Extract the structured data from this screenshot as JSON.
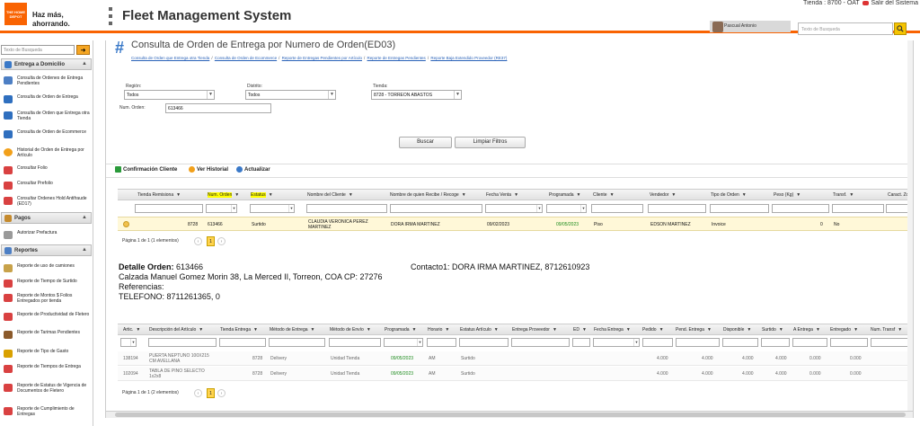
{
  "header": {
    "logo_text": "THE HOME DEPOT",
    "slogan_line1": "Haz más,",
    "slogan_line2": "ahorrando.",
    "app_title": "Fleet Management System",
    "store_info": "Tienda : 8700 - OAT",
    "logout_label": "Salir del Sistema",
    "user_name": "Pascual Antonio",
    "search_placeholder": "Texto de Busqueda"
  },
  "sidebar": {
    "search_placeholder": "Texto de Busqueda",
    "sections": [
      {
        "label": "Entrega a Domicilio"
      },
      {
        "label": "Pagos"
      },
      {
        "label": "Reportes"
      }
    ],
    "delivery_items": [
      {
        "label": "Consulta de Ordenes de Entrega Pendientes"
      },
      {
        "label": "Consulta de Orden de Entrega"
      },
      {
        "label": "Consulta de Orden que Entrega otra Tienda"
      },
      {
        "label": "Consulta de Orden de Ecommerce"
      },
      {
        "label": "Historial de Orden de Entrega por Artículo"
      },
      {
        "label": "Consultar Folio"
      },
      {
        "label": "Consultar Prefolio"
      },
      {
        "label": "Consultar Ordenes Hold Antifraude (ED17)"
      }
    ],
    "payment_items": [
      {
        "label": "Autorizar Prefactura"
      }
    ],
    "report_items": [
      {
        "label": "Reporte de uso de camiones"
      },
      {
        "label": "Reporte de Tiempo de Surtido"
      },
      {
        "label": "Reporte de Montos $ Folios Entregados por tienda"
      },
      {
        "label": "Reporte de Productividad de Fletero"
      },
      {
        "label": "Reporte de Tarimas Pendientes"
      },
      {
        "label": "Reporte de Tipo de Gasto"
      },
      {
        "label": "Reporte de Tiempos de Entrega"
      },
      {
        "label": "Reporte de Estatus de Vigencia de Documentos de Fletero"
      },
      {
        "label": "Reporte de Cumplimiento de Entregas"
      }
    ]
  },
  "page": {
    "title": "Consulta de Orden de Entrega por Numero de Orden(ED03)",
    "breadcrumb": [
      "Consulta de Orden que Entrega otra Tienda",
      "Consulta de Orden de Ecommerce",
      "Reporte de Entregas Pendientes por Artículo",
      "Reporte de Entregas Pendientes",
      "Reporte Baja Extendido Proveedor (RE37)"
    ],
    "dots": "....."
  },
  "filters": {
    "region_label": "Región:",
    "region_value": "Todos",
    "district_label": "Distrito:",
    "district_value": "Todos",
    "store_label": "Tienda:",
    "store_value": "8728 - TORREON ABASTOS",
    "order_label": "Num. Orden:",
    "order_value": "613466",
    "search_button": "Buscar",
    "clear_button": "Limpiar Filtros"
  },
  "toolbar": {
    "confirm_label": "Confirmación Cliente",
    "history_label": "Ver Historial",
    "refresh_label": "Actualizar"
  },
  "orders_grid": {
    "headers": [
      "Tienda Remisiona",
      "Num. Orden",
      "Estatus",
      "Nombre del Cliente",
      "Nombre de quien Recibe / Recoge",
      "Fecha Venta",
      "Programada",
      "Cliente",
      "Vendedor",
      "Tipo de Orden",
      "Peso (Kg)",
      "Transf.",
      "Caract. Zo"
    ],
    "row": {
      "tienda": "8728",
      "orden": "613466",
      "estatus": "Surtido",
      "cliente": "CLAUDIA VERONICA PEREZ MARTINEZ",
      "recibe": "DORA IRMA MARTINEZ",
      "fecha_venta": "09/02/2023",
      "programada": "09/05/2023",
      "tipo_cliente": "Piso",
      "vendedor": "EDSON MARTINEZ",
      "tipo_orden": "Invoice",
      "peso": "0",
      "transf": "No"
    },
    "pager_text": "Página 1 de 1 (1 elementos)",
    "current_page": "1"
  },
  "detail": {
    "title_label": "Detalle Orden:",
    "order_number": "613466",
    "address": "Calzada Manuel Gomez Morin 38, La Merced II, Torreon, COA CP: 27276",
    "references": "Referencias:",
    "phone": "TELEFONO: 8711261365, 0",
    "contact": "Contacto1: DORA IRMA MARTINEZ, 8712610923"
  },
  "items_grid": {
    "headers": [
      "Artic.",
      "Descripción del Artículo",
      "Tienda Entrega",
      "Método de Entrega",
      "Método de Envío",
      "Programada",
      "Horario",
      "Estatus Artículo",
      "Entrega Proveedor",
      "ED",
      "Fecha Entrega",
      "Pedido",
      "Pend. Entrega",
      "Disponible",
      "Surtido",
      "A Entrega",
      "Entregado",
      "Num. Transf"
    ],
    "rows": [
      {
        "artic": "138194",
        "desc": "PUERTA NEPTUNO 100X215 CM AVELLANA",
        "tienda": "8728",
        "metodo": "Delivery",
        "envio": "Unidad Tienda",
        "programada": "09/05/2023",
        "horario": "AM",
        "estatus": "Surtido",
        "pedido": "4.000",
        "pend": "4.000",
        "disp": "4.000",
        "surtido": "4.000",
        "aentrega": "0.000",
        "entregado": "0.000"
      },
      {
        "artic": "102094",
        "desc": "TABLA DE PINO SELECTO 1x2x8",
        "tienda": "8728",
        "metodo": "Delivery",
        "envio": "Unidad Tienda",
        "programada": "09/05/2023",
        "horario": "AM",
        "estatus": "Surtido",
        "pedido": "4.000",
        "pend": "4.000",
        "disp": "4.000",
        "surtido": "4.000",
        "aentrega": "0.000",
        "entregado": "0.000"
      }
    ],
    "pager_text": "Página 1 de 1 (2 elementos)",
    "current_page": "1"
  }
}
